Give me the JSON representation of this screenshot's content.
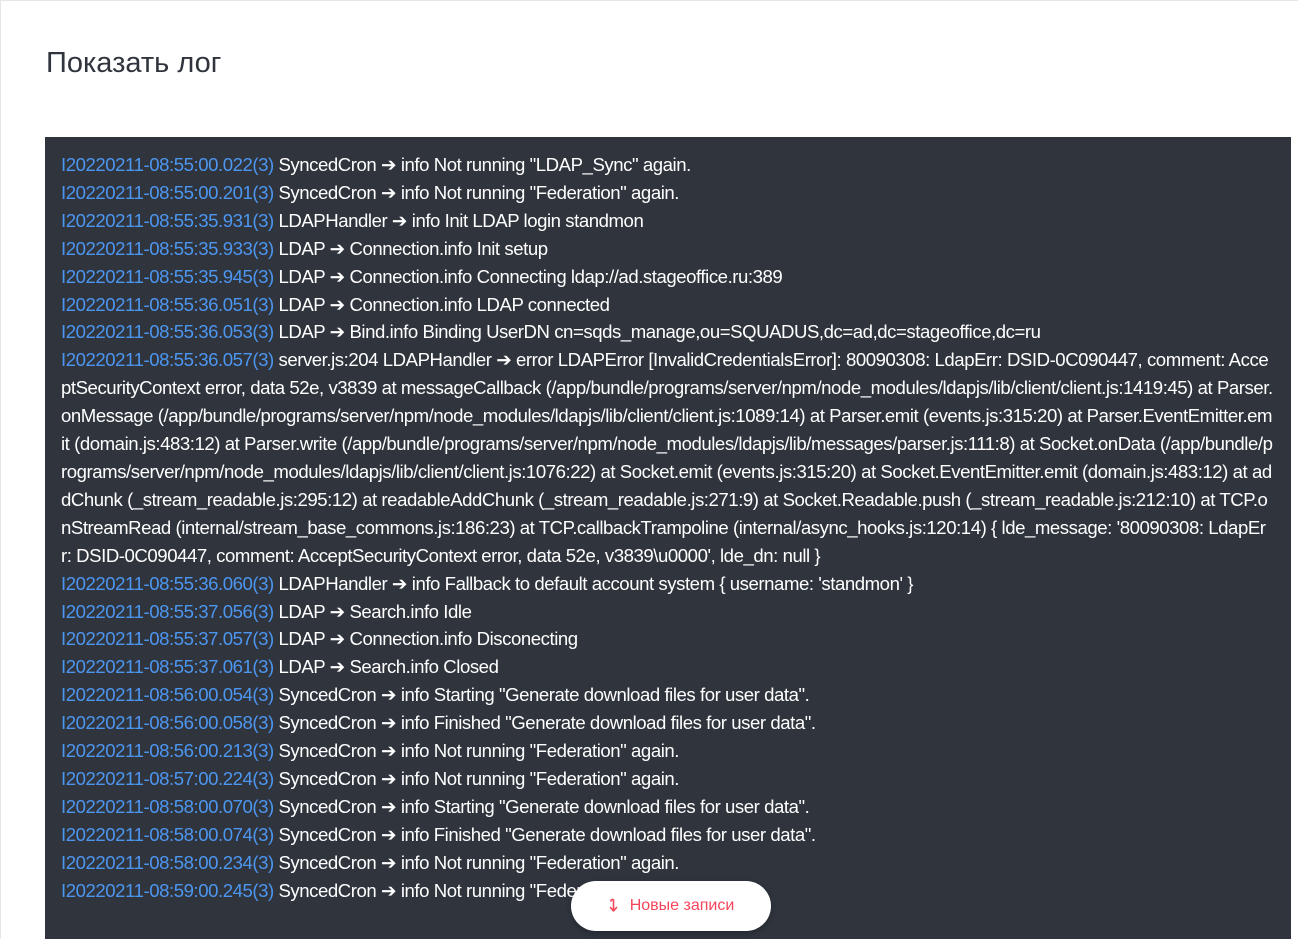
{
  "page": {
    "title": "Показать лог"
  },
  "log": {
    "entries": [
      {
        "ts": "I20220211-08:55:00.022(3)",
        "text": " SyncedCron ➔ info Not running \"LDAP_Sync\" again."
      },
      {
        "ts": "I20220211-08:55:00.201(3)",
        "text": " SyncedCron ➔ info Not running \"Federation\" again."
      },
      {
        "ts": "I20220211-08:55:35.931(3)",
        "text": " LDAPHandler ➔ info Init LDAP login standmon"
      },
      {
        "ts": "I20220211-08:55:35.933(3)",
        "text": " LDAP ➔ Connection.info Init setup"
      },
      {
        "ts": "I20220211-08:55:35.945(3)",
        "text": " LDAP ➔ Connection.info Connecting ldap://ad.stageoffice.ru:389"
      },
      {
        "ts": "I20220211-08:55:36.051(3)",
        "text": " LDAP ➔ Connection.info LDAP connected"
      },
      {
        "ts": "I20220211-08:55:36.053(3)",
        "text": " LDAP ➔ Bind.info Binding UserDN cn=sqds_manage,ou=SQUADUS,dc=ad,dc=stageoffice,dc=ru"
      },
      {
        "ts": "I20220211-08:55:36.057(3)",
        "text": " server.js:204 LDAPHandler ➔ error LDAPError [InvalidCredentialsError]: 80090308: LdapErr: DSID-0C090447, comment: AcceptSecurityContext error, data 52e, v3839    at messageCallback (/app/bundle/programs/server/npm/node_modules/ldapjs/lib/client/client.js:1419:45)    at Parser.onMessage (/app/bundle/programs/server/npm/node_modules/ldapjs/lib/client/client.js:1089:14)    at Parser.emit (events.js:315:20)    at Parser.EventEmitter.emit (domain.js:483:12)    at Parser.write (/app/bundle/programs/server/npm/node_modules/ldapjs/lib/messages/parser.js:111:8)    at Socket.onData (/app/bundle/programs/server/npm/node_modules/ldapjs/lib/client/client.js:1076:22)    at Socket.emit (events.js:315:20)    at Socket.EventEmitter.emit (domain.js:483:12)    at addChunk (_stream_readable.js:295:12)    at readableAddChunk (_stream_readable.js:271:9)    at Socket.Readable.push (_stream_readable.js:212:10)    at TCP.onStreamRead (internal/stream_base_commons.js:186:23)    at TCP.callbackTrampoline (internal/async_hooks.js:120:14) {  lde_message: '80090308: LdapErr: DSID-0C090447, comment: AcceptSecurityContext error, data 52e, v3839\\u0000',  lde_dn: null }"
      },
      {
        "ts": "I20220211-08:55:36.060(3)",
        "text": " LDAPHandler ➔ info Fallback to default account system { username: 'standmon' }"
      },
      {
        "ts": "I20220211-08:55:37.056(3)",
        "text": " LDAP ➔ Search.info Idle"
      },
      {
        "ts": "I20220211-08:55:37.057(3)",
        "text": " LDAP ➔ Connection.info Disconecting"
      },
      {
        "ts": "I20220211-08:55:37.061(3)",
        "text": " LDAP ➔ Search.info Closed"
      },
      {
        "ts": "I20220211-08:56:00.054(3)",
        "text": " SyncedCron ➔ info Starting \"Generate download files for user data\"."
      },
      {
        "ts": "I20220211-08:56:00.058(3)",
        "text": " SyncedCron ➔ info Finished \"Generate download files for user data\"."
      },
      {
        "ts": "I20220211-08:56:00.213(3)",
        "text": " SyncedCron ➔ info Not running \"Federation\" again."
      },
      {
        "ts": "I20220211-08:57:00.224(3)",
        "text": " SyncedCron ➔ info Not running \"Federation\" again."
      },
      {
        "ts": "I20220211-08:58:00.070(3)",
        "text": " SyncedCron ➔ info Starting \"Generate download files for user data\"."
      },
      {
        "ts": "I20220211-08:58:00.074(3)",
        "text": " SyncedCron ➔ info Finished \"Generate download files for user data\"."
      },
      {
        "ts": "I20220211-08:58:00.234(3)",
        "text": " SyncedCron ➔ info Not running \"Federation\" again."
      },
      {
        "ts": "I20220211-08:59:00.245(3)",
        "text": " SyncedCron ➔ info Not running \"Federation\" again."
      }
    ]
  },
  "new_records": {
    "label": "Новые записи",
    "icon": "arrow-down-icon"
  },
  "colors": {
    "log_background": "#2f343d",
    "timestamp": "#4d96f0",
    "log_text": "#ffffff",
    "new_records_accent": "#f5455c"
  }
}
